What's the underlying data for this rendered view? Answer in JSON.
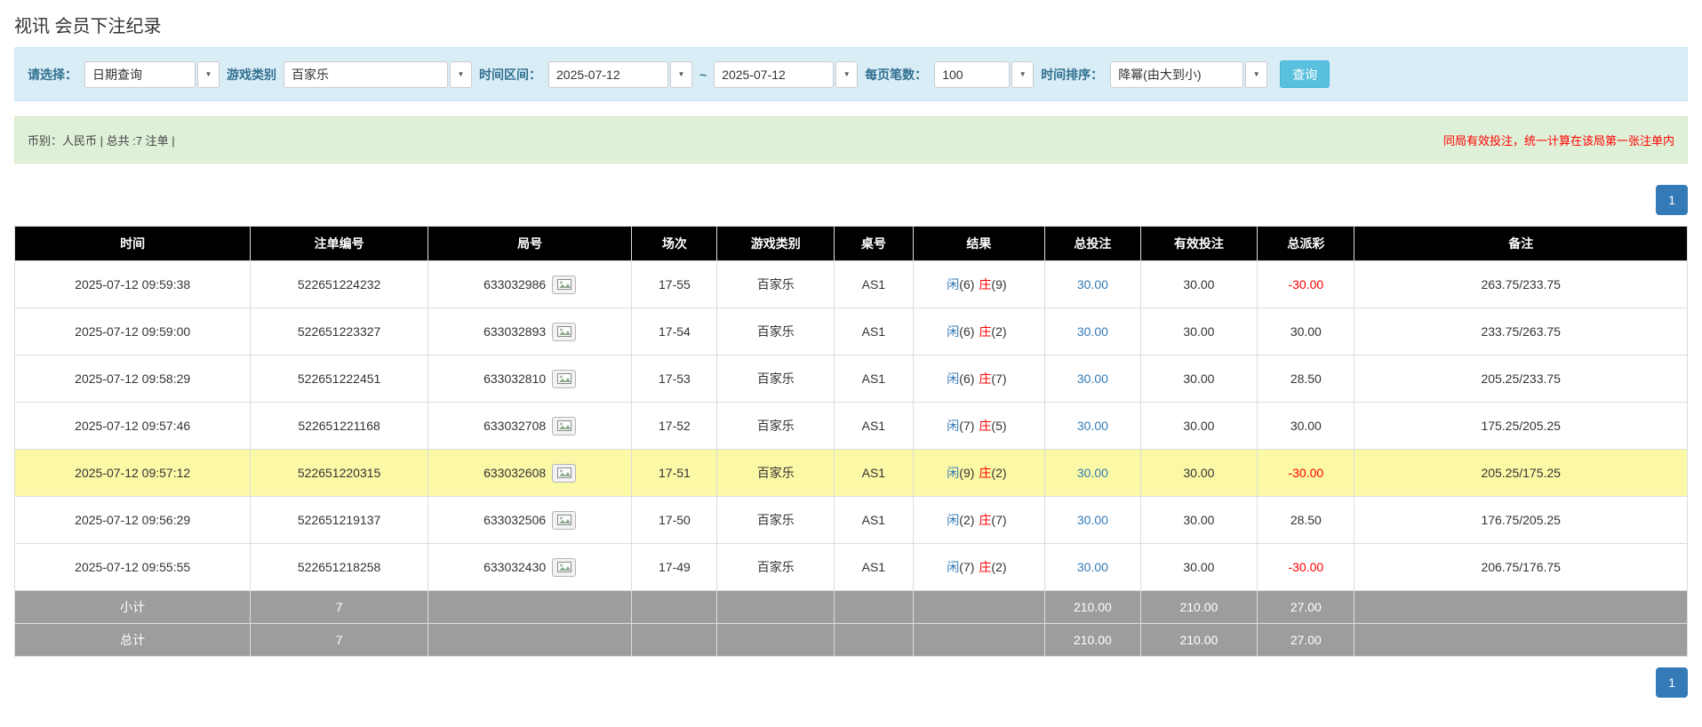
{
  "page": {
    "title": "视讯 会员下注纪录"
  },
  "colors": {
    "accent_blue": "#337ab7",
    "negative_red": "#ff0000",
    "highlight_yellow": "#fbf9a6",
    "header_black": "#000000",
    "filter_bg": "#d9edf7",
    "summary_bg": "#dff0d8",
    "query_button": "#5bc0de",
    "footer_gray": "#9d9d9d"
  },
  "icons": {
    "caret": "▼",
    "round_detail": "cards-photo-icon"
  },
  "filters": {
    "select_label": "请选择：",
    "select_value": "日期查询",
    "game_type_label": "游戏类别",
    "game_type_value": "百家乐",
    "time_range_label": "时间区间：",
    "date_from": "2025-07-12",
    "tilde": "~",
    "date_to": "2025-07-12",
    "page_size_label": "每页笔数：",
    "page_size_value": "100",
    "sort_label": "时间排序：",
    "sort_value": "降幂(由大到小)",
    "query_button": "查询"
  },
  "summary": {
    "left": "币别：人民币 | 总共 :7 注单 |",
    "right": "同局有效投注，统一计算在该局第一张注单内"
  },
  "pagination": {
    "page": "1"
  },
  "table": {
    "headers": [
      "时间",
      "注单编号",
      "局号",
      "场次",
      "游戏类别",
      "桌号",
      "结果",
      "总投注",
      "有效投注",
      "总派彩",
      "备注"
    ],
    "rows": [
      {
        "time": "2025-07-12 09:59:38",
        "bet_id": "522651224232",
        "round_id": "633032986",
        "session": "17-55",
        "game_type": "百家乐",
        "table_no": "AS1",
        "result_player": "闲",
        "result_player_score": "(6)",
        "result_banker": "庄",
        "result_banker_score": "(9)",
        "total_bet": "30.00",
        "valid_bet": "30.00",
        "payout": "-30.00",
        "payout_negative": true,
        "remark": "263.75/233.75",
        "highlight": false
      },
      {
        "time": "2025-07-12 09:59:00",
        "bet_id": "522651223327",
        "round_id": "633032893",
        "session": "17-54",
        "game_type": "百家乐",
        "table_no": "AS1",
        "result_player": "闲",
        "result_player_score": "(6)",
        "result_banker": "庄",
        "result_banker_score": "(2)",
        "total_bet": "30.00",
        "valid_bet": "30.00",
        "payout": "30.00",
        "payout_negative": false,
        "remark": "233.75/263.75",
        "highlight": false
      },
      {
        "time": "2025-07-12 09:58:29",
        "bet_id": "522651222451",
        "round_id": "633032810",
        "session": "17-53",
        "game_type": "百家乐",
        "table_no": "AS1",
        "result_player": "闲",
        "result_player_score": "(6)",
        "result_banker": "庄",
        "result_banker_score": "(7)",
        "total_bet": "30.00",
        "valid_bet": "30.00",
        "payout": "28.50",
        "payout_negative": false,
        "remark": "205.25/233.75",
        "highlight": false
      },
      {
        "time": "2025-07-12 09:57:46",
        "bet_id": "522651221168",
        "round_id": "633032708",
        "session": "17-52",
        "game_type": "百家乐",
        "table_no": "AS1",
        "result_player": "闲",
        "result_player_score": "(7)",
        "result_banker": "庄",
        "result_banker_score": "(5)",
        "total_bet": "30.00",
        "valid_bet": "30.00",
        "payout": "30.00",
        "payout_negative": false,
        "remark": "175.25/205.25",
        "highlight": false
      },
      {
        "time": "2025-07-12 09:57:12",
        "bet_id": "522651220315",
        "round_id": "633032608",
        "session": "17-51",
        "game_type": "百家乐",
        "table_no": "AS1",
        "result_player": "闲",
        "result_player_score": "(9)",
        "result_banker": "庄",
        "result_banker_score": "(2)",
        "total_bet": "30.00",
        "valid_bet": "30.00",
        "payout": "-30.00",
        "payout_negative": true,
        "remark": "205.25/175.25",
        "highlight": true
      },
      {
        "time": "2025-07-12 09:56:29",
        "bet_id": "522651219137",
        "round_id": "633032506",
        "session": "17-50",
        "game_type": "百家乐",
        "table_no": "AS1",
        "result_player": "闲",
        "result_player_score": "(2)",
        "result_banker": "庄",
        "result_banker_score": "(7)",
        "total_bet": "30.00",
        "valid_bet": "30.00",
        "payout": "28.50",
        "payout_negative": false,
        "remark": "176.75/205.25",
        "highlight": false
      },
      {
        "time": "2025-07-12 09:55:55",
        "bet_id": "522651218258",
        "round_id": "633032430",
        "session": "17-49",
        "game_type": "百家乐",
        "table_no": "AS1",
        "result_player": "闲",
        "result_player_score": "(7)",
        "result_banker": "庄",
        "result_banker_score": "(2)",
        "total_bet": "30.00",
        "valid_bet": "30.00",
        "payout": "-30.00",
        "payout_negative": true,
        "remark": "206.75/176.75",
        "highlight": false
      }
    ],
    "subtotal": {
      "label": "小计",
      "count": "7",
      "total_bet": "210.00",
      "valid_bet": "210.00",
      "payout": "27.00"
    },
    "total": {
      "label": "总计",
      "count": "7",
      "total_bet": "210.00",
      "valid_bet": "210.00",
      "payout": "27.00"
    }
  }
}
